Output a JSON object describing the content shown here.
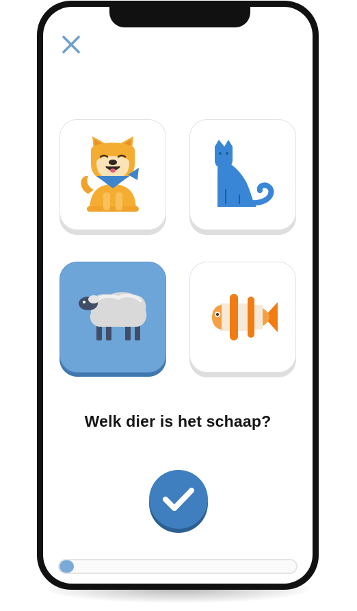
{
  "app": {
    "close_icon": "close-icon",
    "accent_color": "#3f7fc0"
  },
  "quiz": {
    "question": "Welk dier is het schaap?",
    "options": [
      {
        "animal": "dog",
        "icon": "dog-icon",
        "selected": false
      },
      {
        "animal": "cat",
        "icon": "cat-icon",
        "selected": false
      },
      {
        "animal": "sheep",
        "icon": "sheep-icon",
        "selected": true
      },
      {
        "animal": "fish",
        "icon": "fish-icon",
        "selected": false
      }
    ],
    "check_icon": "checkmark-icon",
    "progress_fraction": 0.06
  }
}
